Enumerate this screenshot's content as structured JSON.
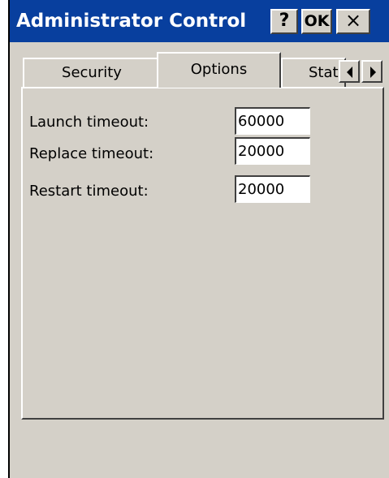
{
  "window": {
    "title": "Administrator Control",
    "help_label": "?",
    "ok_label": "OK",
    "close_label": "×"
  },
  "tabs": [
    {
      "label": "Security",
      "active": false
    },
    {
      "label": "Options",
      "active": true
    },
    {
      "label": "Status",
      "active": false
    }
  ],
  "tab_scroll": {
    "left_icon": "arrow-left-icon",
    "right_icon": "arrow-right-icon"
  },
  "options": {
    "fields": [
      {
        "label": "Launch timeout:",
        "value": "60000"
      },
      {
        "label": "Replace timeout:",
        "value": "20000"
      },
      {
        "label": "Restart timeout:",
        "value": "20000"
      }
    ]
  },
  "colors": {
    "titlebar": "#083f9e",
    "face": "#d4d0c8",
    "input_bg": "#ffffff"
  }
}
